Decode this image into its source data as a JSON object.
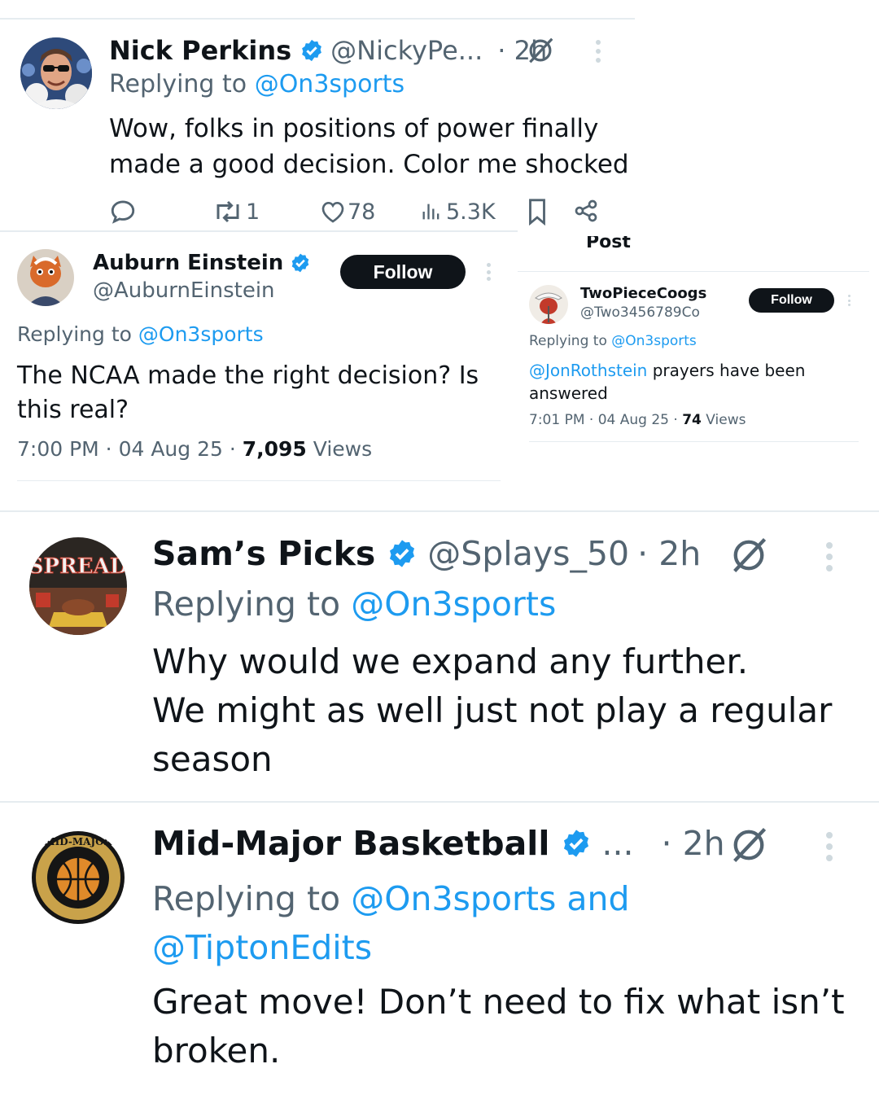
{
  "tweet1": {
    "name": "Nick Perkins",
    "handle": "@NickyPe...",
    "time": "· 2h",
    "replying_prefix": "Replying to",
    "replying_to": "@On3sports",
    "text_line1": "Wow, folks in positions of power finally",
    "text_line2": "made a good decision. Color me shocked",
    "retweets": "1",
    "likes": "78",
    "views": "5.3K"
  },
  "tweet2": {
    "name": "Auburn Einstein",
    "handle": "@AuburnEinstein",
    "follow_label": "Follow",
    "replying_prefix": "Replying to",
    "replying_to": "@On3sports",
    "text_line1": "The NCAA made the right decision? Is",
    "text_line2": "this real?",
    "timestamp": "7:00 PM · 04 Aug 25 · ",
    "view_count": "7,095",
    "views_label": " Views"
  },
  "tweet3": {
    "header_fragment": "Post",
    "name": "TwoPieceCoogs",
    "handle": "@Two3456789Co",
    "follow_label": "Follow",
    "replying_prefix": "Replying to",
    "replying_to": "@On3sports",
    "mention": "@JonRothstein",
    "text_rest": " prayers have been",
    "text_line2": "answered",
    "timestamp": "7:01 PM · 04 Aug 25 · ",
    "view_count": "74",
    "views_label": " Views"
  },
  "tweet4": {
    "name": "Sam’s Picks",
    "handle": "@Splays_50",
    "time": "· 2h",
    "avatar_text": "SPREAD",
    "replying_prefix": "Replying to",
    "replying_to": "@On3sports",
    "text_line1": "Why would we expand any further.",
    "text_line2": "We might as well just not play a regular",
    "text_line3": "season"
  },
  "tweet5": {
    "name": "Mid-Major Basketball",
    "ellipsis": "...",
    "time": "· 2h",
    "avatar_text": "MID-MAJOR",
    "replying_prefix": "Replying to",
    "replying_to_line1": "@On3sports and",
    "replying_to_line2": "@TiptonEdits",
    "text_line1": "Great move! Don’t need to fix what isn’t",
    "text_line2": "broken."
  },
  "colors": {
    "link": "#1d9bf0",
    "gray": "#536471",
    "verified": "#1d9bf0",
    "follow_bg": "#0f1419"
  },
  "icons": [
    "verified-badge-icon",
    "grok-icon",
    "more-icon",
    "reply-icon",
    "retweet-icon",
    "like-icon",
    "views-icon",
    "bookmark-icon",
    "share-icon"
  ]
}
